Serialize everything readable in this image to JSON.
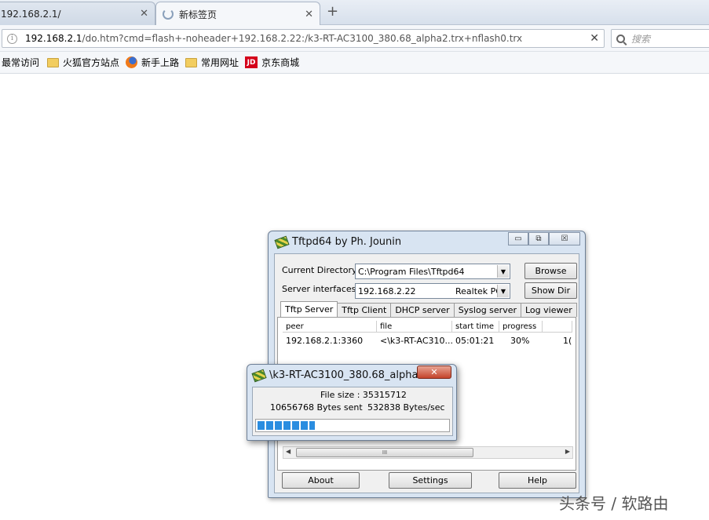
{
  "browser": {
    "tabs": [
      {
        "label": "192.168.2.1/",
        "active": false
      },
      {
        "label": "新标签页",
        "active": true
      }
    ],
    "new_tab_label": "+",
    "url_host": "192.168.2.1",
    "url_rest": "/do.htm?cmd=flash+-noheader+192.168.2.22:/k3-RT-AC3100_380.68_alpha2.trx+nflash0.trx",
    "url_clear_label": "✕",
    "search_placeholder": "搜索",
    "bookmarks": [
      {
        "label": "最常访问",
        "icon": "none"
      },
      {
        "label": "火狐官方站点",
        "icon": "folder-icon"
      },
      {
        "label": "新手上路",
        "icon": "firefox-icon"
      },
      {
        "label": "常用网址",
        "icon": "folder-icon"
      },
      {
        "label": "京东商城",
        "icon": "jd-icon",
        "icon_text": "JD"
      }
    ]
  },
  "tftpd": {
    "title": "Tftpd64 by Ph. Jounin",
    "controls": {
      "minimize": "▭",
      "restore": "⧉",
      "close": "☒"
    },
    "current_directory_label": "Current Directory",
    "current_directory_value": "C:\\Program Files\\Tftpd64",
    "server_interfaces_label": "Server interfaces",
    "server_ip": "192.168.2.22",
    "server_adapter": "Realtek PC",
    "browse_label": "Browse",
    "show_dir_label": "Show Dir",
    "tabs": [
      "Tftp Server",
      "Tftp Client",
      "DHCP server",
      "Syslog server",
      "Log viewer"
    ],
    "selected_tab": "Tftp Server",
    "columns": [
      "peer",
      "file",
      "start time",
      "progress",
      ""
    ],
    "rows": [
      {
        "peer": "192.168.2.1:3360",
        "file": "<\\k3-RT-AC310...",
        "start_time": "05:01:21",
        "progress": "30%",
        "extra": "1("
      }
    ],
    "scroll_grip": "III",
    "about_label": "About",
    "settings_label": "Settings",
    "help_label": "Help"
  },
  "transfer": {
    "title": "\\k3-RT-AC3100_380.68_alpha...",
    "close_label": "✕",
    "file_size_line": "File size : 35315712",
    "bytes_sent": "10656768 Bytes sent",
    "rate": "532838 Bytes/sec",
    "progress_fraction": 0.3
  },
  "watermark": "头条号 / 软路由"
}
